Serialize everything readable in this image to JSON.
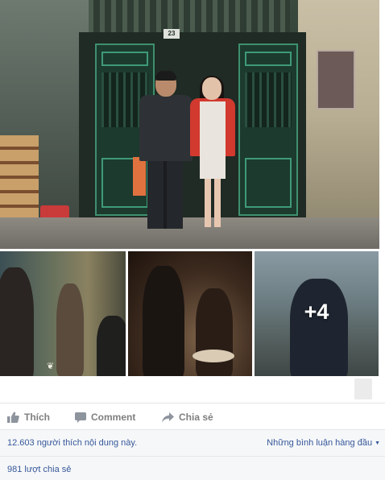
{
  "post": {
    "photos": {
      "house_number": "23",
      "more_count": "+4",
      "corner_logo": "❦"
    },
    "actions": {
      "like_label": "Thích",
      "comment_label": "Comment",
      "share_label": "Chia sẻ"
    },
    "stats": {
      "likes_text": "12.603 người thích nội dung này.",
      "comment_order_label": "Những bình luận hàng đầu",
      "shares_text": "981 lượt chia sẻ"
    }
  },
  "icons": {
    "like": "thumbs-up-icon",
    "comment": "speech-bubble-icon",
    "share": "share-arrow-icon",
    "dropdown": "caret-down-icon"
  },
  "colors": {
    "link": "#365899",
    "action_text": "#7f7f7f",
    "stats_bg": "#f6f7f9",
    "divider": "#e5e6e9"
  }
}
